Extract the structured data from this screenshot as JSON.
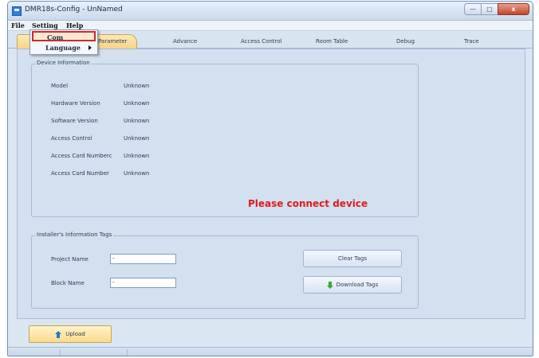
{
  "window": {
    "title": "DMR18s-Config - UnNamed"
  },
  "menu": {
    "file": "File",
    "setting": "Setting",
    "help": "Help",
    "dropdown": {
      "com": "Com",
      "language": "Language"
    }
  },
  "tabs": [
    "Parameter",
    "Advance",
    "Access Control",
    "Room Table",
    "Debug",
    "Trace"
  ],
  "device_info": {
    "legend": "Device Information",
    "rows": [
      {
        "label": "Model",
        "value": "Unknown"
      },
      {
        "label": "Hardware Version",
        "value": "Unknown"
      },
      {
        "label": "Software Version",
        "value": "Unknown"
      },
      {
        "label": "Access Control",
        "value": "Unknown"
      },
      {
        "label": "Access Card Numberc",
        "value": "Unknown"
      },
      {
        "label": "Access Card Number",
        "value": "Unknown"
      }
    ],
    "message": "Please connect device"
  },
  "installer": {
    "legend": "Installer's Information Tags",
    "project_label": "Project Name",
    "project_value": "-",
    "block_label": "Block Name",
    "block_value": "-",
    "clear_button": "Clear Tags",
    "download_button": "Download Tags"
  },
  "upload_button": "Upload",
  "colors": {
    "message": "#e01b1b",
    "active_tab": "#f6d487"
  },
  "icons": {
    "download": "download-arrow-icon",
    "upload": "upload-arrow-icon"
  }
}
